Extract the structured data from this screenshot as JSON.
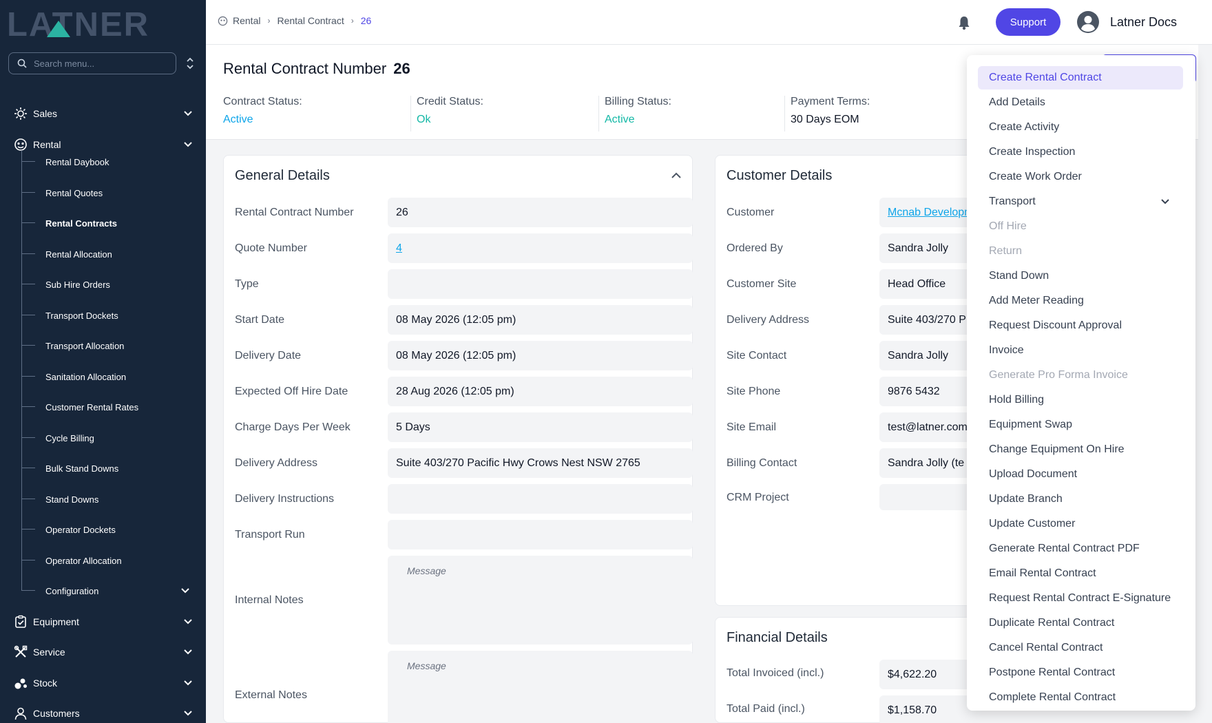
{
  "sidebar": {
    "logo_text": "LATNER",
    "search_placeholder": "Search menu...",
    "groups": [
      {
        "label": "Sales"
      },
      {
        "label": "Rental"
      },
      {
        "label": "Equipment"
      },
      {
        "label": "Service"
      },
      {
        "label": "Stock"
      },
      {
        "label": "Customers"
      }
    ],
    "rental_items": [
      {
        "label": "Rental Daybook"
      },
      {
        "label": "Rental Quotes"
      },
      {
        "label": "Rental Contracts"
      },
      {
        "label": "Rental Allocation"
      },
      {
        "label": "Sub Hire Orders"
      },
      {
        "label": "Transport Dockets"
      },
      {
        "label": "Transport Allocation"
      },
      {
        "label": "Sanitation Allocation"
      },
      {
        "label": "Customer Rental Rates"
      },
      {
        "label": "Cycle Billing"
      },
      {
        "label": "Bulk Stand Downs"
      },
      {
        "label": "Stand Downs"
      },
      {
        "label": "Operator Dockets"
      },
      {
        "label": "Operator Allocation"
      },
      {
        "label": "Configuration"
      }
    ]
  },
  "topbar": {
    "breadcrumb": [
      "Rental",
      "Rental Contract",
      "26"
    ],
    "support_label": "Support",
    "user_name": "Latner Docs"
  },
  "header": {
    "title": "Rental Contract Number",
    "number": "26",
    "statuses": [
      {
        "label": "Contract Status:",
        "value": "Active"
      },
      {
        "label": "Credit Status:",
        "value": "Ok"
      },
      {
        "label": "Billing Status:",
        "value": "Active"
      },
      {
        "label": "Payment Terms:",
        "value": "30 Days EOM"
      }
    ]
  },
  "general": {
    "title": "General Details",
    "rows": [
      {
        "label": "Rental Contract Number",
        "value": "26"
      },
      {
        "label": "Quote Number",
        "value": "4"
      },
      {
        "label": "Type",
        "value": ""
      },
      {
        "label": "Start Date",
        "value": "08 May 2026 (12:05 pm)"
      },
      {
        "label": "Delivery Date",
        "value": "08 May 2026 (12:05 pm)"
      },
      {
        "label": "Expected Off Hire Date",
        "value": "28 Aug 2026 (12:05 pm)"
      },
      {
        "label": "Charge Days Per Week",
        "value": "5 Days"
      },
      {
        "label": "Delivery Address",
        "value": "Suite 403/270 Pacific Hwy Crows Nest NSW 2765"
      },
      {
        "label": "Delivery Instructions",
        "value": ""
      },
      {
        "label": "Transport Run",
        "value": ""
      },
      {
        "label": "Internal Notes",
        "placeholder": "Message"
      },
      {
        "label": "External Notes",
        "placeholder": "Message"
      }
    ]
  },
  "customer": {
    "title": "Customer Details",
    "rows": [
      {
        "label": "Customer",
        "value": "Mcnab Developm"
      },
      {
        "label": "Ordered By",
        "value": "Sandra Jolly"
      },
      {
        "label": "Customer Site",
        "value": "Head Office"
      },
      {
        "label": "Delivery Address",
        "value": "Suite 403/270 P"
      },
      {
        "label": "Site Contact",
        "value": "Sandra Jolly"
      },
      {
        "label": "Site Phone",
        "value": "9876 5432"
      },
      {
        "label": "Site Email",
        "value": "test@latner.com"
      },
      {
        "label": "Billing Contact",
        "value": "Sandra Jolly (te"
      },
      {
        "label": "CRM Project",
        "value": ""
      }
    ]
  },
  "financial": {
    "title": "Financial Details",
    "rows": [
      {
        "label": "Total Invoiced (incl.)",
        "value": "$4,622.20"
      },
      {
        "label": "Total Paid (incl.)",
        "value": "$1,158.70"
      }
    ]
  },
  "actions_menu": {
    "items": [
      {
        "label": "Create Rental Contract"
      },
      {
        "label": "Add Details"
      },
      {
        "label": "Create Activity"
      },
      {
        "label": "Create Inspection"
      },
      {
        "label": "Create Work Order"
      },
      {
        "label": "Transport"
      },
      {
        "label": "Off Hire"
      },
      {
        "label": "Return"
      },
      {
        "label": "Stand Down"
      },
      {
        "label": "Add Meter Reading"
      },
      {
        "label": "Request Discount Approval"
      },
      {
        "label": "Invoice"
      },
      {
        "label": "Generate Pro Forma Invoice"
      },
      {
        "label": "Hold Billing"
      },
      {
        "label": "Equipment Swap"
      },
      {
        "label": "Change Equipment On Hire"
      },
      {
        "label": "Upload Document"
      },
      {
        "label": "Update Branch"
      },
      {
        "label": "Update Customer"
      },
      {
        "label": "Generate Rental Contract PDF"
      },
      {
        "label": "Email Rental Contract"
      },
      {
        "label": "Request Rental Contract E-Signature"
      },
      {
        "label": "Duplicate Rental Contract"
      },
      {
        "label": "Cancel Rental Contract"
      },
      {
        "label": "Postpone Rental Contract"
      },
      {
        "label": "Complete Rental Contract"
      }
    ]
  },
  "colors": {
    "sidebar_bg": "#17263a",
    "accent": "#5046e5",
    "status_teal": "#14b8a6",
    "status_blue": "#0ea5e9"
  }
}
